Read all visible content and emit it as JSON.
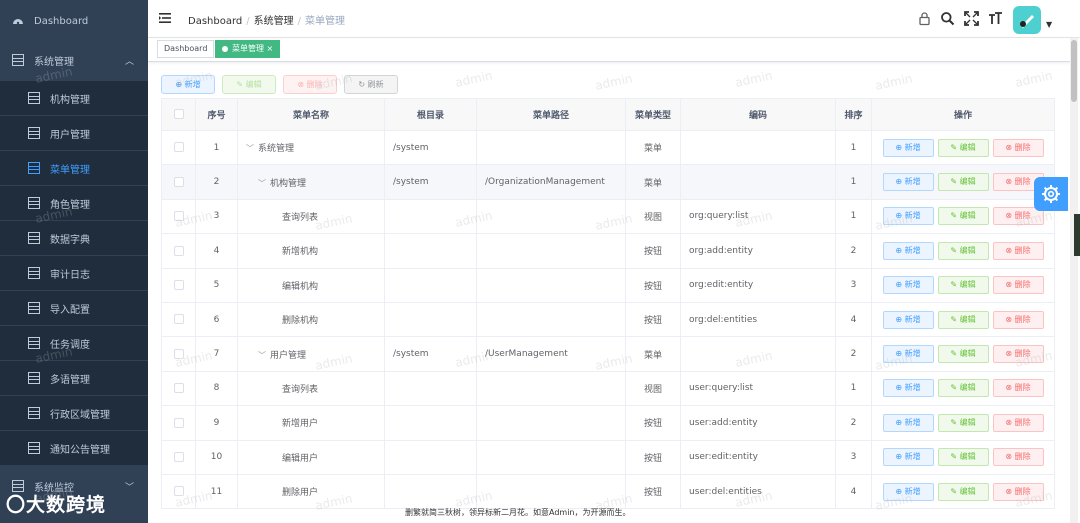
{
  "sidebar": {
    "top_item": "Dashboard",
    "group": "系统管理",
    "items": [
      "机构管理",
      "用户管理",
      "菜单管理",
      "角色管理",
      "数据字典",
      "审计日志",
      "导入配置",
      "任务调度",
      "多语管理",
      "行政区域管理",
      "通知公告管理"
    ],
    "active_item": "菜单管理",
    "group2": "系统监控"
  },
  "navbar": {
    "breadcrumb": [
      "Dashboard",
      "系统管理",
      "菜单管理"
    ],
    "icons": [
      "lock-icon",
      "search-icon",
      "fullscreen-icon",
      "font-size-icon"
    ]
  },
  "tags": {
    "items": [
      "Dashboard",
      "菜单管理"
    ],
    "close": "×"
  },
  "toolbar": {
    "add": "新增",
    "edit": "编辑",
    "delete": "删除",
    "refresh": "刷新"
  },
  "table": {
    "headers": [
      "序号",
      "菜单名称",
      "根目录",
      "菜单路径",
      "菜单类型",
      "编码",
      "排序",
      "操作"
    ],
    "rows": [
      {
        "no": "1",
        "name": "系统管理",
        "root": "/system",
        "path": "",
        "type": "菜单",
        "code": "",
        "sort": "1"
      },
      {
        "no": "2",
        "name": "机构管理",
        "root": "/system",
        "path": "/OrganizationManagement",
        "type": "菜单",
        "code": "",
        "sort": "1"
      },
      {
        "no": "3",
        "name": "查询列表",
        "root": "",
        "path": "",
        "type": "视图",
        "code": "org:query:list",
        "sort": "1"
      },
      {
        "no": "4",
        "name": "新增机构",
        "root": "",
        "path": "",
        "type": "按钮",
        "code": "org:add:entity",
        "sort": "2"
      },
      {
        "no": "5",
        "name": "编辑机构",
        "root": "",
        "path": "",
        "type": "按钮",
        "code": "org:edit:entity",
        "sort": "3"
      },
      {
        "no": "6",
        "name": "删除机构",
        "root": "",
        "path": "",
        "type": "按钮",
        "code": "org:del:entities",
        "sort": "4"
      },
      {
        "no": "7",
        "name": "用户管理",
        "root": "/system",
        "path": "/UserManagement",
        "type": "菜单",
        "code": "",
        "sort": "2"
      },
      {
        "no": "8",
        "name": "查询列表",
        "root": "",
        "path": "",
        "type": "视图",
        "code": "user:query:list",
        "sort": "1"
      },
      {
        "no": "9",
        "name": "新增用户",
        "root": "",
        "path": "",
        "type": "按钮",
        "code": "user:add:entity",
        "sort": "2"
      },
      {
        "no": "10",
        "name": "编辑用户",
        "root": "",
        "path": "",
        "type": "按钮",
        "code": "user:edit:entity",
        "sort": "3"
      },
      {
        "no": "11",
        "name": "删除用户",
        "root": "",
        "path": "",
        "type": "按钮",
        "code": "user:del:entities",
        "sort": "4"
      }
    ],
    "row_actions": {
      "add": "新增",
      "edit": "编辑",
      "delete": "删除"
    }
  },
  "watermark": "admin",
  "footer": "删繁就简三秋树，领异标新二月花。如意Admin，为开源而生。",
  "logo_text": "大数跨境",
  "colors": {
    "sidebar": "#304156",
    "primary": "#409eff",
    "tag_active": "#42b983",
    "danger": "#f56c6c",
    "success": "#67c23a"
  }
}
